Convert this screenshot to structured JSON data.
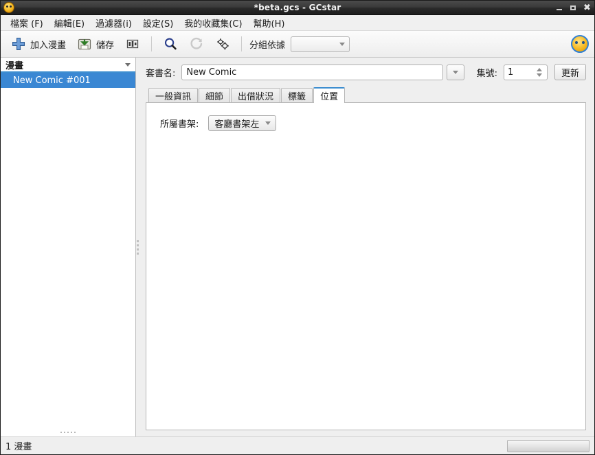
{
  "window": {
    "title": "*beta.gcs - GCstar",
    "app_icon": "gcstar-smiley-icon",
    "minimize_label": "",
    "maximize_label": "",
    "close_label": "✖"
  },
  "menubar": {
    "items": [
      {
        "label": "檔案 (F)",
        "name": "menu-file"
      },
      {
        "label": "編輯(E)",
        "name": "menu-edit"
      },
      {
        "label": "過濾器(i)",
        "name": "menu-filter"
      },
      {
        "label": "設定(S)",
        "name": "menu-settings"
      },
      {
        "label": "我的收藏集(C)",
        "name": "menu-collection"
      },
      {
        "label": "幫助(H)",
        "name": "menu-help"
      }
    ]
  },
  "toolbar": {
    "add_label": "加入漫畫",
    "add_icon": "plus-icon",
    "save_label": "儲存",
    "save_icon": "save-disk-icon",
    "columns_icon": "columns-layout-icon",
    "search_icon": "search-magnifier-icon",
    "reload_icon": "reload-circular-arrow-icon",
    "settings_icon": "gears-icon",
    "group_by_label": "分組依據",
    "group_by_value": "",
    "logo_icon": "gcstar-logo-icon"
  },
  "sidebar": {
    "header_label": "漫畫",
    "header_icon": "chevron-down-icon",
    "items": [
      {
        "label": "New Comic #001",
        "selected": true
      }
    ]
  },
  "form": {
    "series_label": "套書名:",
    "series_value": "New Comic",
    "series_placeholder": "",
    "series_dropdown_icon": "chevron-down-icon",
    "number_label": "集號:",
    "number_value": "1",
    "update_label": "更新"
  },
  "tabs": {
    "items": [
      {
        "label": "一般資訊",
        "name": "tab-general",
        "active": false
      },
      {
        "label": "細節",
        "name": "tab-details",
        "active": false
      },
      {
        "label": "出借狀況",
        "name": "tab-lending",
        "active": false
      },
      {
        "label": "標籤",
        "name": "tab-tags",
        "active": false
      },
      {
        "label": "位置",
        "name": "tab-location",
        "active": true
      }
    ]
  },
  "location_panel": {
    "shelf_label": "所屬書架:",
    "shelf_value": "客廳書架左",
    "shelf_icon": "chevron-down-icon"
  },
  "statusbar": {
    "count_text": "1 漫畫"
  },
  "colors": {
    "accent": "#3e8ed0",
    "selection": "#3a87d3",
    "titlebar": "#2a2a2a",
    "chrome": "#efefef",
    "panel": "#ffffff"
  }
}
